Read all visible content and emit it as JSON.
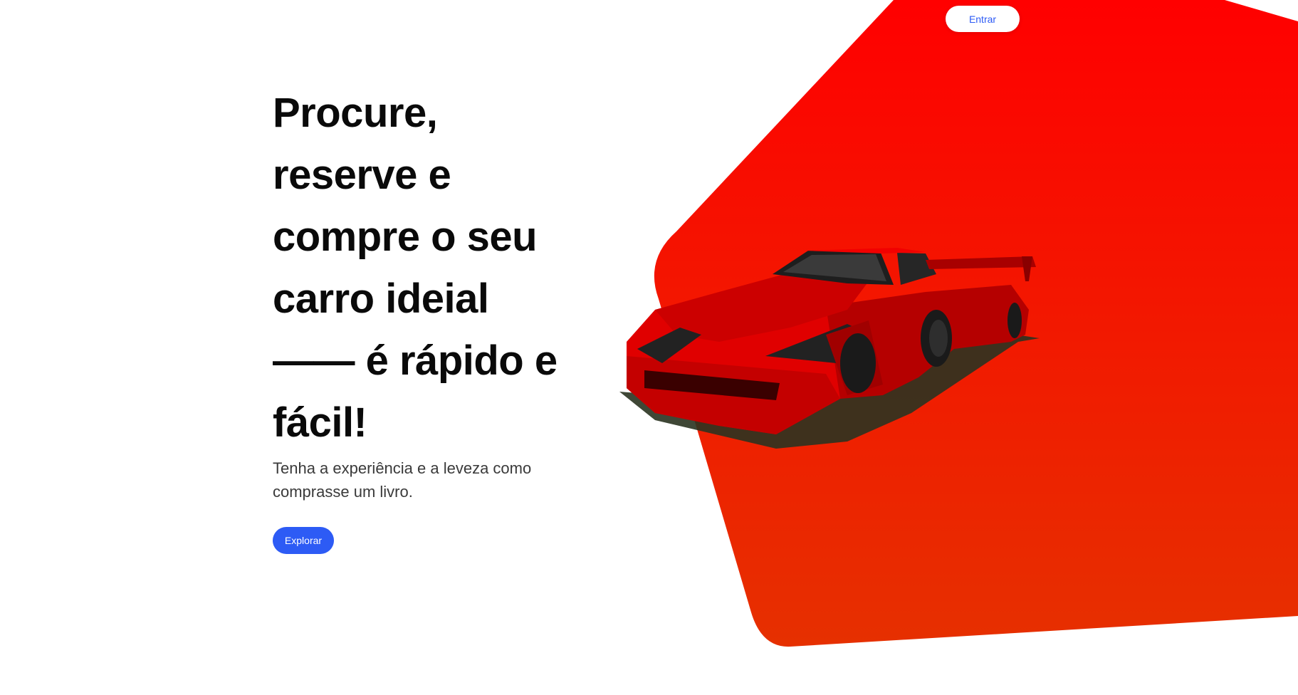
{
  "header": {
    "login_label": "Entrar"
  },
  "hero": {
    "headline": "Procure, reserve e compre o seu carro ideial —— é rápido e fácil!",
    "subtitle": "Tenha a experiência e a leveza como comprasse um livro.",
    "cta_label": "Explorar"
  },
  "colors": {
    "accent": "#2d5bf5",
    "shape_top": "#ff0000",
    "shape_bottom": "#e63000",
    "car_body": "#d80000"
  }
}
